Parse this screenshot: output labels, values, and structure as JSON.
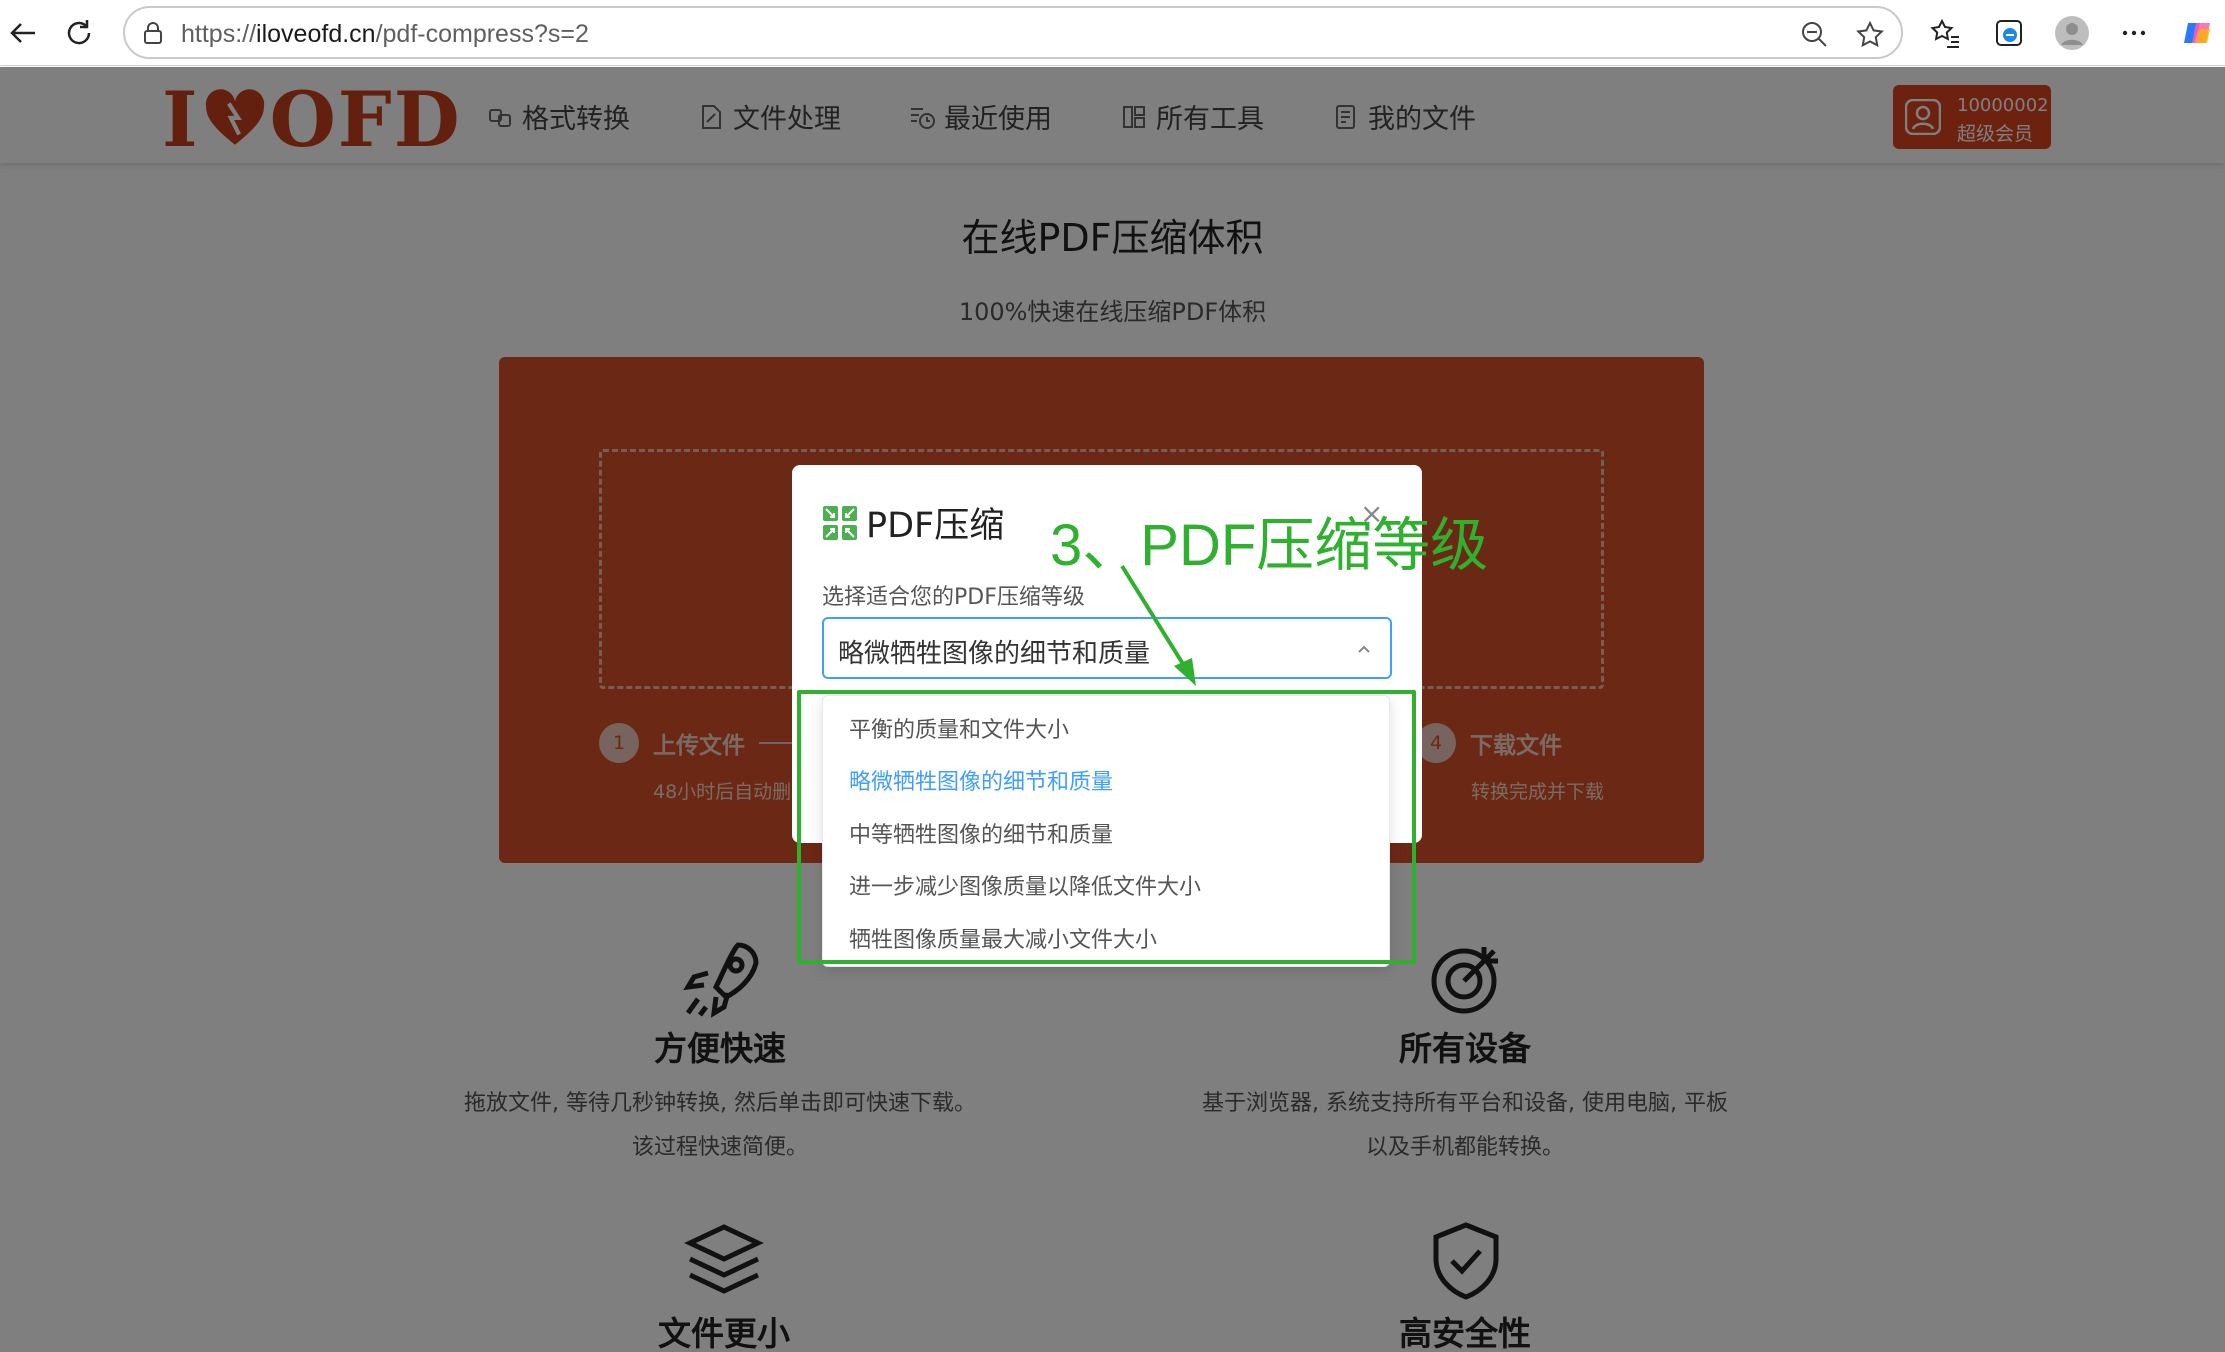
{
  "browser": {
    "url_prefix": "https://",
    "url_host": "iloveofd.cn",
    "url_path": "/pdf-compress?s=2"
  },
  "site": {
    "logo_left": "I",
    "logo_right": "OFD",
    "nav": [
      "格式转换",
      "文件处理",
      "最近使用",
      "所有工具",
      "我的文件"
    ],
    "member_id": "10000002",
    "member_level": "超级会员"
  },
  "hero": {
    "title": "在线PDF压缩体积",
    "subtitle": "100%快速在线压缩PDF体积"
  },
  "steps": {
    "one": {
      "num": "1",
      "label": "上传文件",
      "desc": "48小时后自动删"
    },
    "four": {
      "num": "4",
      "label": "下载文件",
      "desc": "转换完成并下载"
    }
  },
  "features": {
    "fast": {
      "title": "方便快速",
      "desc1": "拖放文件, 等待几秒钟转换, 然后单击即可快速下载。",
      "desc2": "该过程快速简便。"
    },
    "devices": {
      "title": "所有设备",
      "desc1": "基于浏览器, 系统支持所有平台和设备, 使用电脑, 平板",
      "desc2": "以及手机都能转换。"
    },
    "smaller": {
      "title": "文件更小"
    },
    "secure": {
      "title": "高安全性"
    }
  },
  "modal": {
    "title": "PDF压缩",
    "close": "×",
    "label": "选择适合您的PDF压缩等级",
    "selected": "略微牺牲图像的细节和质量"
  },
  "dropdown": {
    "options": [
      "平衡的质量和文件大小",
      "略微牺牲图像的细节和质量",
      "中等牺牲图像的细节和质量",
      "进一步减少图像质量以降低文件大小",
      "牺牲图像质量最大减小文件大小"
    ],
    "active_index": 1
  },
  "annotation": {
    "text": "3、PDF压缩等级",
    "color": "#2fb02f"
  },
  "colors": {
    "brand": "#c8411f",
    "panel": "#d6502a",
    "accent": "#409eff"
  }
}
